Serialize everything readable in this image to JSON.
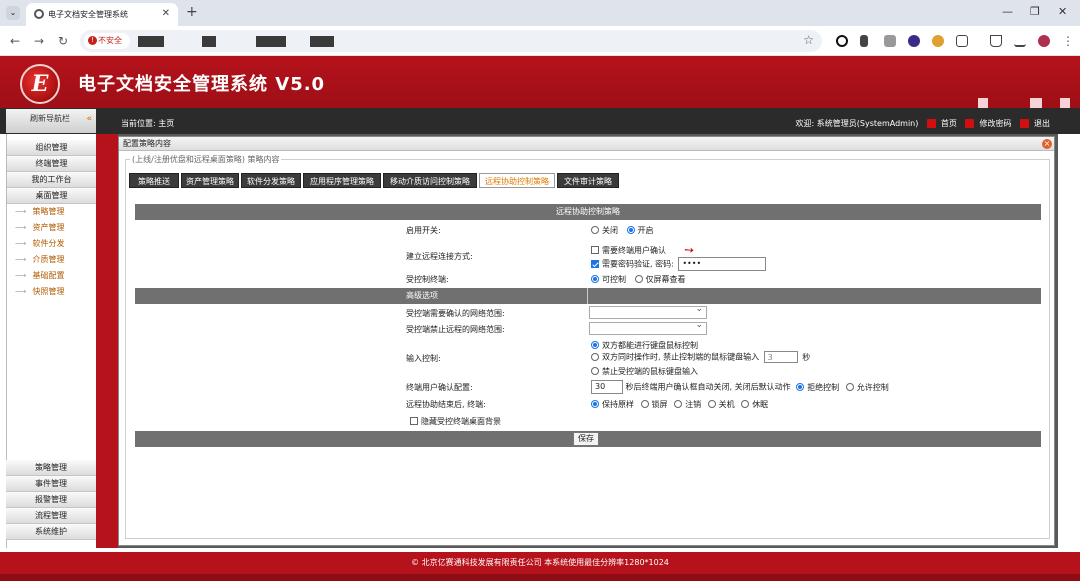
{
  "browser": {
    "tab_title": "电子文档安全管理系统",
    "security_label": "不安全"
  },
  "app": {
    "title": "电子文档安全管理系统 V5.0",
    "logo_letter": "E"
  },
  "subbar": {
    "nav_header": "刷新导航栏",
    "location": "当前位置: 主页",
    "welcome": "欢迎: 系统管理员(SystemAdmin)",
    "home": "首页",
    "change_password": "修改密码",
    "logout": "退出"
  },
  "leftnav": {
    "groups_top": [
      "组织管理",
      "终端管理",
      "我的工作台",
      "桌面管理"
    ],
    "subitems": [
      "策略管理",
      "资产管理",
      "软件分发",
      "介质管理",
      "基础配置",
      "快照管理"
    ],
    "groups_bottom": [
      "策略管理",
      "事件管理",
      "报警管理",
      "流程管理",
      "系统维护"
    ]
  },
  "panel": {
    "title": "配置策略内容",
    "legend": "(上线/注册优盘和远程桌面策略) 策略内容",
    "tabs": [
      "策略推送",
      "资产管理策略",
      "软件分发策略",
      "应用程序管理策略",
      "移动介质访问控制策略",
      "远程协助控制策略",
      "文件审计策略"
    ],
    "active_tab_index": 5
  },
  "form": {
    "section_title": "远程协助控制策略",
    "enable_label": "启用开关:",
    "enable_options": [
      "关闭",
      "开启"
    ],
    "enable_selected": "开启",
    "connect_label": "建立远程连接方式:",
    "connect_opt1": "需要终端用户确认",
    "connect_opt2": "需要密码验证, 密码:",
    "password_value": "••••",
    "controlled_label": "受控制终端:",
    "controlled_options": [
      "可控制",
      "仅屏幕查看"
    ],
    "advanced_title": "高级选项",
    "need_confirm_label": "受控端需要确认的网络范围:",
    "forbid_label": "受控端禁止远程的网络范围:",
    "input_label": "输入控制:",
    "input_opt1": "双方都能进行键盘鼠标控制",
    "input_opt2": "双方同时操作时, 禁止控制端的鼠标键盘输入",
    "input_opt2_seconds": "3",
    "input_opt2_unit": "秒",
    "input_opt3": "禁止受控端的鼠标键盘输入",
    "confirm_cfg_label": "终端用户确认配置:",
    "confirm_seconds": "30",
    "confirm_text": "秒后终端用户确认框自动关闭, 关闭后默认动作",
    "confirm_options": [
      "拒绝控制",
      "允许控制"
    ],
    "after_label": "远程协助结束后, 终端:",
    "after_options": [
      "保持原样",
      "锁屏",
      "注销",
      "关机",
      "休眠"
    ],
    "hide_bg_label": "隐藏受控终端桌面背景",
    "save_label": "保存"
  },
  "footer": {
    "text": "© 北京亿赛通科技发展有限责任公司  本系统使用最佳分辨率1280*1024"
  }
}
